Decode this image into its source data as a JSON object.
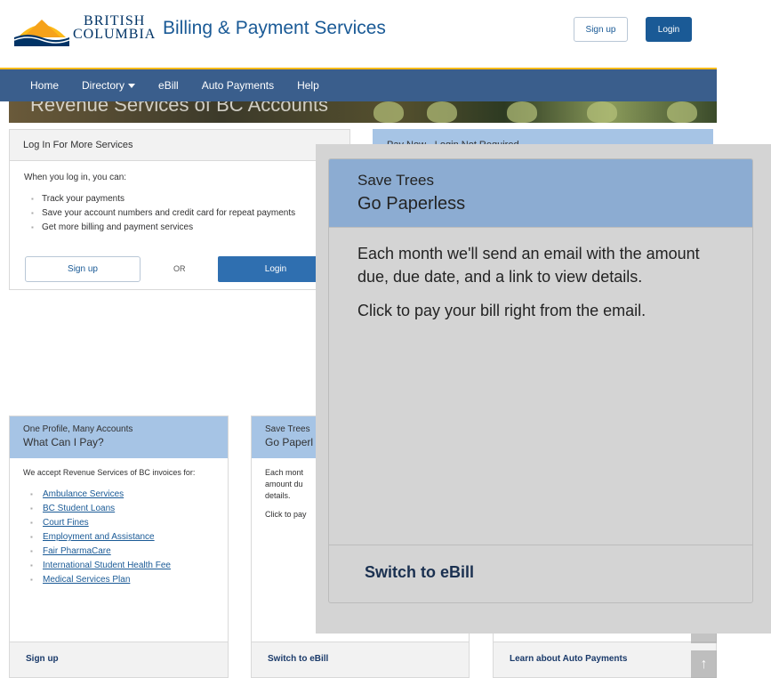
{
  "header": {
    "logo_line1": "BRITISH",
    "logo_line2": "COLUMBIA",
    "title": "Billing & Payment Services",
    "signup_label": "Sign up",
    "login_label": "Login"
  },
  "nav": {
    "items": [
      {
        "label": "Home"
      },
      {
        "label": "Directory"
      },
      {
        "label": "eBill"
      },
      {
        "label": "Auto Payments"
      },
      {
        "label": "Help"
      }
    ]
  },
  "banner": {
    "text": "Revenue Services of BC Accounts"
  },
  "login_card": {
    "title": "Log In For More Services",
    "intro": "When you log in, you can:",
    "items": [
      "Track your payments",
      "Save your account numbers and credit card for repeat payments",
      "Get more billing and payment services"
    ],
    "signup_label": "Sign up",
    "or_label": "OR",
    "login_label": "Login"
  },
  "paynow_card": {
    "title": "Pay Now - Login Not Required"
  },
  "cards": [
    {
      "title_small": "One Profile, Many Accounts",
      "title_big": "What Can I Pay?",
      "body": "We accept Revenue Services of BC invoices for:",
      "links": [
        "Ambulance Services",
        "BC Student Loans",
        "Court Fines",
        "Employment and Assistance",
        "Fair PharmaCare",
        "International Student Health Fee",
        "Medical Services Plan"
      ],
      "footer": "Sign up"
    },
    {
      "title_small": "Save Trees",
      "title_big": "Go Paperl",
      "body1": "Each mont",
      "body2": "amount du",
      "body3": "details.",
      "body4": "Click to pay",
      "footer": "Switch to eBill"
    },
    {
      "footer": "Learn about Auto Payments"
    }
  ],
  "popup": {
    "title_small": "Save Trees",
    "title_big": "Go Paperless",
    "para1": "Each month we'll send an email with the amount due, due date, and a link to view details.",
    "para2": "Click to pay your bill right from the email.",
    "footer": "Switch to eBill"
  },
  "colors": {
    "brand_blue": "#1a5a96",
    "nav_bg": "#3a5e8c",
    "nav_accent": "#fcba19",
    "card_head_blue": "#a6c4e5",
    "popup_head_blue": "#8cacd2"
  }
}
